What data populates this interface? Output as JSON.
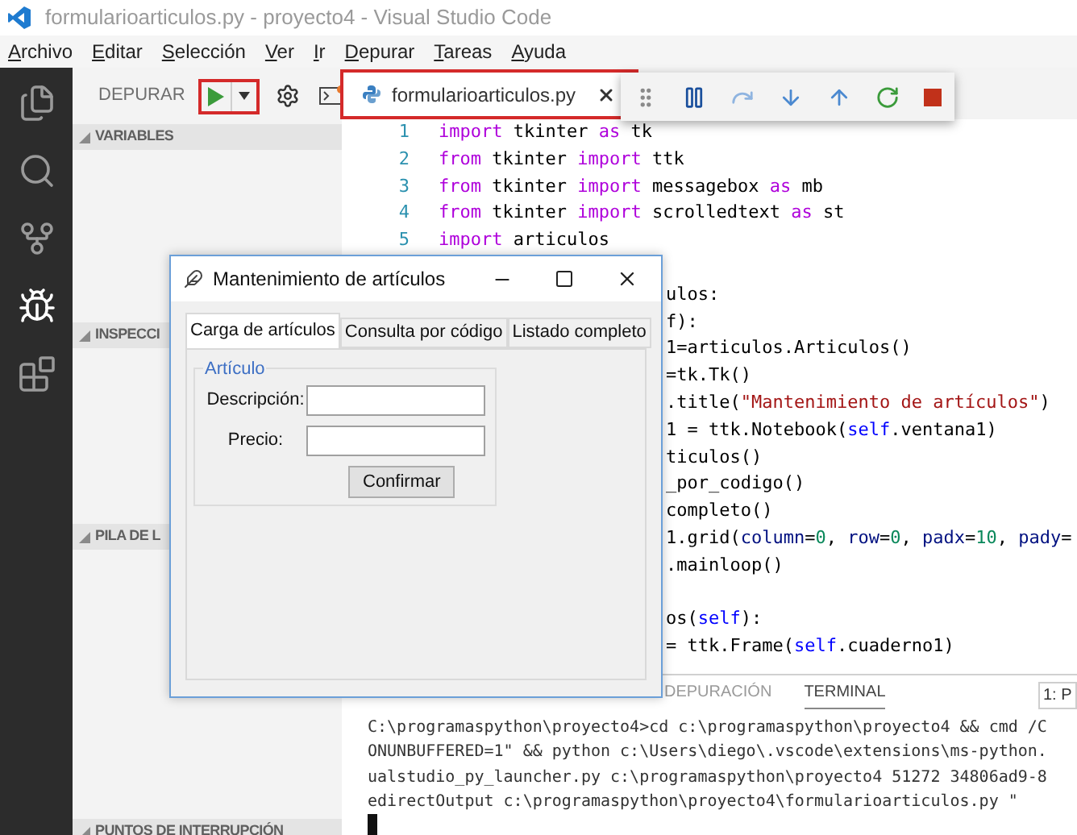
{
  "window": {
    "title": "formularioarticulos.py - proyecto4 - Visual Studio Code"
  },
  "menu": [
    {
      "label": "Archivo"
    },
    {
      "label": "Editar"
    },
    {
      "label": "Selección"
    },
    {
      "label": "Ver"
    },
    {
      "label": "Ir"
    },
    {
      "label": "Depurar"
    },
    {
      "label": "Tareas"
    },
    {
      "label": "Ayuda"
    }
  ],
  "activity_bar": [
    {
      "kind": "files",
      "selected": false
    },
    {
      "kind": "search",
      "selected": false
    },
    {
      "kind": "git",
      "selected": false
    },
    {
      "kind": "debug",
      "selected": true
    },
    {
      "kind": "extensions",
      "selected": false
    }
  ],
  "sidebar": {
    "title": "DEPURAR",
    "sections": [
      {
        "label": "VARIABLES",
        "expanded": true
      },
      {
        "label": "INSPECCI",
        "expanded": true
      },
      {
        "label": "PILA DE L",
        "expanded": true
      },
      {
        "label": "PUNTOS DE INTERRUPCIÓN",
        "expanded": true
      }
    ]
  },
  "editor": {
    "tabs": [
      {
        "label": "formularioarticulos.py",
        "selected": true
      }
    ],
    "debug_toolbar": [
      {
        "kind": "grip"
      },
      {
        "kind": "pause"
      },
      {
        "kind": "step-over"
      },
      {
        "kind": "step-into"
      },
      {
        "kind": "step-out"
      },
      {
        "kind": "restart"
      },
      {
        "kind": "stop"
      }
    ],
    "lines": [
      {
        "kind": "full",
        "number": "1",
        "segments": [
          {
            "kind": "keyword",
            "text": "import"
          },
          {
            "kind": "plain",
            "text": " tkinter "
          },
          {
            "kind": "keyword",
            "text": "as"
          },
          {
            "kind": "plain",
            "text": " tk"
          }
        ]
      },
      {
        "kind": "full",
        "number": "2",
        "segments": [
          {
            "kind": "keyword",
            "text": "from"
          },
          {
            "kind": "plain",
            "text": " tkinter "
          },
          {
            "kind": "keyword",
            "text": "import"
          },
          {
            "kind": "plain",
            "text": " ttk"
          }
        ]
      },
      {
        "kind": "full",
        "number": "3",
        "segments": [
          {
            "kind": "keyword",
            "text": "from"
          },
          {
            "kind": "plain",
            "text": " tkinter "
          },
          {
            "kind": "keyword",
            "text": "import"
          },
          {
            "kind": "plain",
            "text": " messagebox "
          },
          {
            "kind": "keyword",
            "text": "as"
          },
          {
            "kind": "plain",
            "text": " mb"
          }
        ]
      },
      {
        "kind": "full",
        "number": "4",
        "segments": [
          {
            "kind": "keyword",
            "text": "from"
          },
          {
            "kind": "plain",
            "text": " tkinter "
          },
          {
            "kind": "keyword",
            "text": "import"
          },
          {
            "kind": "plain",
            "text": " scrolledtext "
          },
          {
            "kind": "keyword",
            "text": "as"
          },
          {
            "kind": "plain",
            "text": " st"
          }
        ]
      },
      {
        "kind": "full",
        "number": "5",
        "segments": [
          {
            "kind": "keyword",
            "text": "import"
          },
          {
            "kind": "plain",
            "text": " articulos"
          }
        ]
      },
      {
        "kind": "blank"
      },
      {
        "kind": "partial",
        "segments": [
          {
            "kind": "plain",
            "text": "ulos:"
          }
        ]
      },
      {
        "kind": "partial",
        "segments": [
          {
            "kind": "plain",
            "text": "f):"
          }
        ]
      },
      {
        "kind": "partial",
        "segments": [
          {
            "kind": "plain",
            "text": "1=articulos.Articulos()"
          }
        ]
      },
      {
        "kind": "partial",
        "segments": [
          {
            "kind": "plain",
            "text": "=tk.Tk()"
          }
        ]
      },
      {
        "kind": "partial",
        "segments": [
          {
            "kind": "plain",
            "text": ".title("
          },
          {
            "kind": "string",
            "text": "\"Mantenimiento de artículos\""
          },
          {
            "kind": "plain",
            "text": ")"
          }
        ]
      },
      {
        "kind": "partial",
        "segments": [
          {
            "kind": "plain",
            "text": "1 = ttk.Notebook("
          },
          {
            "kind": "self",
            "text": "self"
          },
          {
            "kind": "plain",
            "text": ".ventana1)"
          }
        ]
      },
      {
        "kind": "partial",
        "segments": [
          {
            "kind": "plain",
            "text": "ticulos()"
          }
        ]
      },
      {
        "kind": "partial",
        "segments": [
          {
            "kind": "plain",
            "text": "_por_codigo()"
          }
        ]
      },
      {
        "kind": "partial",
        "segments": [
          {
            "kind": "plain",
            "text": "completo()"
          }
        ]
      },
      {
        "kind": "partial",
        "segments": [
          {
            "kind": "plain",
            "text": "1.grid("
          },
          {
            "kind": "param",
            "text": "column"
          },
          {
            "kind": "plain",
            "text": "="
          },
          {
            "kind": "number",
            "text": "0"
          },
          {
            "kind": "plain",
            "text": ", "
          },
          {
            "kind": "param",
            "text": "row"
          },
          {
            "kind": "plain",
            "text": "="
          },
          {
            "kind": "number",
            "text": "0"
          },
          {
            "kind": "plain",
            "text": ", "
          },
          {
            "kind": "param",
            "text": "padx"
          },
          {
            "kind": "plain",
            "text": "="
          },
          {
            "kind": "number",
            "text": "10"
          },
          {
            "kind": "plain",
            "text": ", "
          },
          {
            "kind": "param",
            "text": "pady"
          },
          {
            "kind": "plain",
            "text": "="
          }
        ]
      },
      {
        "kind": "partial",
        "segments": [
          {
            "kind": "plain",
            "text": ".mainloop()"
          }
        ]
      },
      {
        "kind": "blank"
      },
      {
        "kind": "partial",
        "segments": [
          {
            "kind": "plain",
            "text": "os("
          },
          {
            "kind": "self",
            "text": "self"
          },
          {
            "kind": "plain",
            "text": "):"
          }
        ]
      },
      {
        "kind": "partial",
        "segments": [
          {
            "kind": "plain",
            "text": "= ttk.Frame("
          },
          {
            "kind": "self",
            "text": "self"
          },
          {
            "kind": "plain",
            "text": ".cuaderno1)"
          }
        ]
      }
    ]
  },
  "panel": {
    "tabs": [
      {
        "label": "DEPURACIÓN",
        "selected": false
      },
      {
        "label": "TERMINAL",
        "selected": true
      }
    ],
    "terminal_select": "1: P",
    "terminal_lines": [
      "C:\\programaspython\\proyecto4>cd c:\\programaspython\\proyecto4 && cmd /C",
      "ONUNBUFFERED=1\" && python c:\\Users\\diego\\.vscode\\extensions\\ms-python.",
      "ualstudio_py_launcher.py c:\\programaspython\\proyecto4 51272 34806ad9-8",
      "edirectOutput c:\\programaspython\\proyecto4\\formularioarticulos.py \""
    ]
  },
  "dialog": {
    "title": "Mantenimiento de artículos",
    "tabs": [
      {
        "label": "Carga de artículos",
        "selected": true
      },
      {
        "label": "Consulta por código",
        "selected": false
      },
      {
        "label": "Listado completo",
        "selected": false
      }
    ],
    "group": "Artículo",
    "fields": [
      {
        "label": "Descripción:"
      },
      {
        "label": "Precio:"
      }
    ],
    "button": "Confirmar"
  }
}
